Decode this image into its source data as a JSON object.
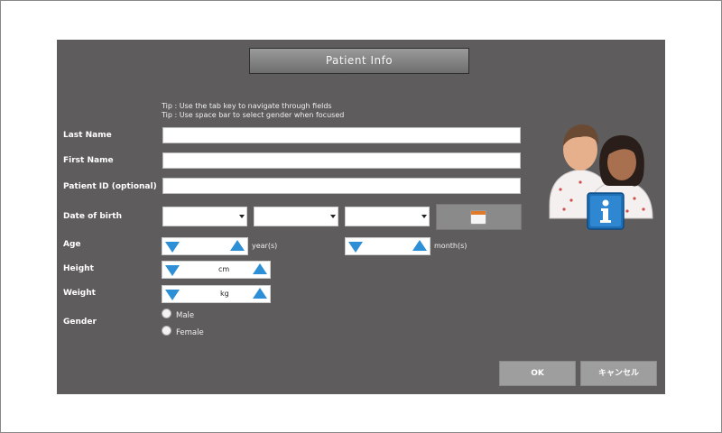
{
  "dialog": {
    "title": "Patient Info",
    "tips": [
      "Tip : Use the tab key to navigate through fields",
      "Tip : Use space bar to select gender when focused"
    ]
  },
  "form": {
    "last_name_label": "Last Name",
    "first_name_label": "First Name",
    "patient_id_label": "Patient ID  (optional)",
    "dob_label": "Date of birth",
    "age_label": "Age",
    "height_label": "Height",
    "weight_label": "Weight",
    "gender_label": "Gender",
    "last_name_value": "",
    "first_name_value": "",
    "patient_id_value": "",
    "age_years_unit": "year(s)",
    "age_months_unit": "month(s)",
    "height_unit": "cm",
    "weight_unit": "kg",
    "gender_options": [
      "Male",
      "Female"
    ]
  },
  "buttons": {
    "ok": "OK",
    "cancel": "キャンセル"
  },
  "icons": [
    "calendar-icon",
    "patient-info-icon",
    "stepper-down-icon",
    "stepper-up-icon",
    "dropdown-arrow-icon"
  ],
  "colors": {
    "dialog_bg": "#5e5c5d",
    "stepper_arrow": "#2d8fd5",
    "info_badge": "#1f6fb5"
  }
}
